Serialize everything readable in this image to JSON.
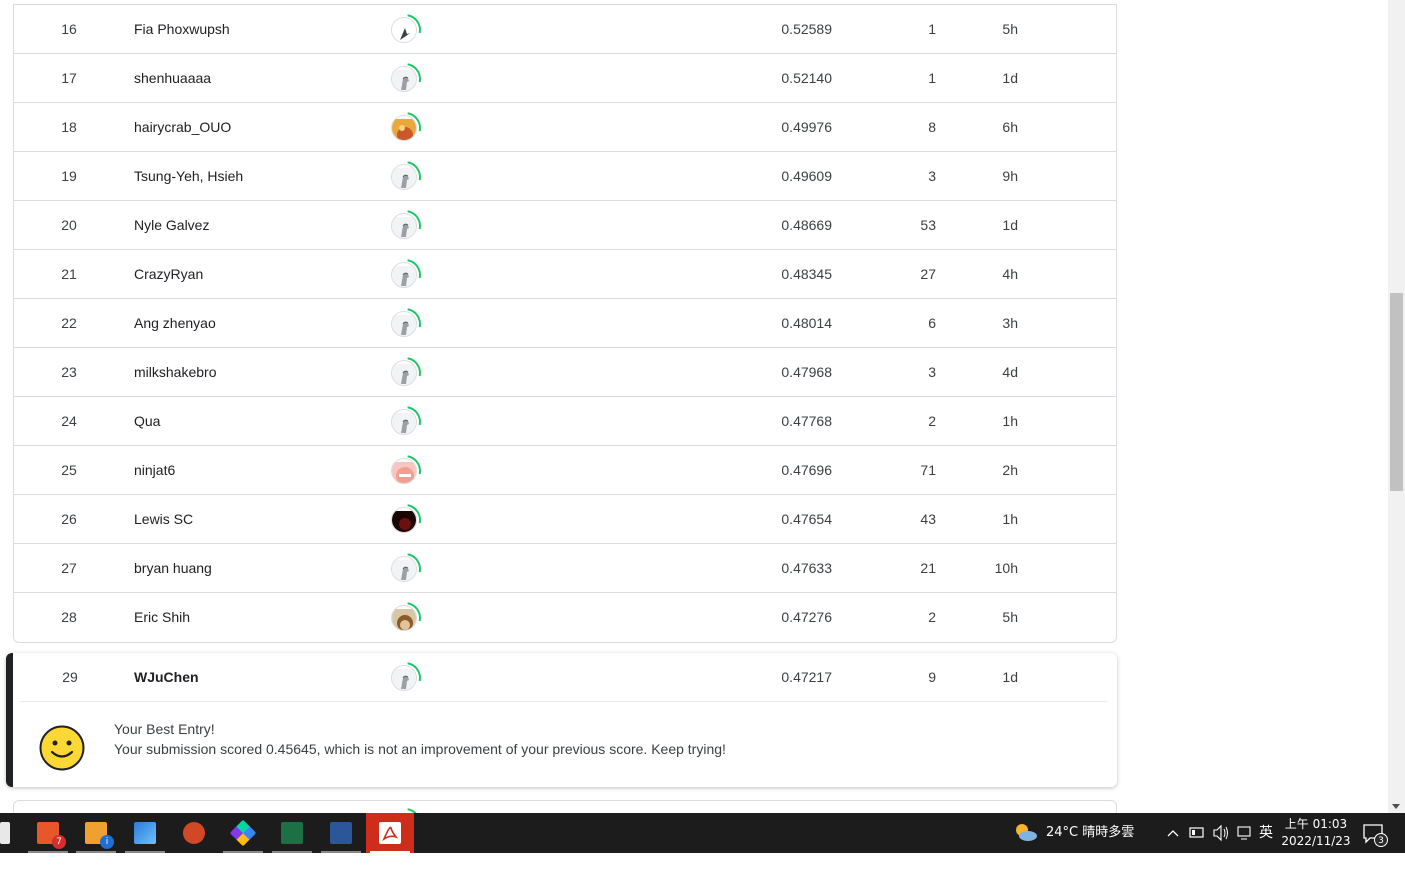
{
  "leaderboard": {
    "rows": [
      {
        "rank": "16",
        "name": "Fia Phoxwupsh",
        "score": "0.52589",
        "entries": "1",
        "last": "5h",
        "avatar": "logo"
      },
      {
        "rank": "17",
        "name": "shenhuaaaa",
        "score": "0.52140",
        "entries": "1",
        "last": "1d",
        "avatar": "default"
      },
      {
        "rank": "18",
        "name": "hairycrab_OUO",
        "score": "0.49976",
        "entries": "8",
        "last": "6h",
        "avatar": "orange"
      },
      {
        "rank": "19",
        "name": "Tsung-Yeh, Hsieh",
        "score": "0.49609",
        "entries": "3",
        "last": "9h",
        "avatar": "default"
      },
      {
        "rank": "20",
        "name": "Nyle Galvez",
        "score": "0.48669",
        "entries": "53",
        "last": "1d",
        "avatar": "default"
      },
      {
        "rank": "21",
        "name": "CrazyRyan",
        "score": "0.48345",
        "entries": "27",
        "last": "4h",
        "avatar": "default"
      },
      {
        "rank": "22",
        "name": "Ang zhenyao",
        "score": "0.48014",
        "entries": "6",
        "last": "3h",
        "avatar": "default"
      },
      {
        "rank": "23",
        "name": "milkshakebro",
        "score": "0.47968",
        "entries": "3",
        "last": "4d",
        "avatar": "default"
      },
      {
        "rank": "24",
        "name": "Qua",
        "score": "0.47768",
        "entries": "2",
        "last": "1h",
        "avatar": "default"
      },
      {
        "rank": "25",
        "name": "ninjat6",
        "score": "0.47696",
        "entries": "71",
        "last": "2h",
        "avatar": "pink"
      },
      {
        "rank": "26",
        "name": "Lewis SC",
        "score": "0.47654",
        "entries": "43",
        "last": "1h",
        "avatar": "dark"
      },
      {
        "rank": "27",
        "name": "bryan huang",
        "score": "0.47633",
        "entries": "21",
        "last": "10h",
        "avatar": "default"
      },
      {
        "rank": "28",
        "name": "Eric Shih",
        "score": "0.47276",
        "entries": "2",
        "last": "5h",
        "avatar": "photo"
      }
    ]
  },
  "my_entry": {
    "rank": "29",
    "name": "WJuChen",
    "score": "0.47217",
    "entries": "9",
    "last": "1d",
    "title": "Your Best Entry!",
    "message": "Your submission scored 0.45645, which is not an improvement of your previous score. Keep trying!"
  },
  "taskbar": {
    "apps": [
      "file-explorer",
      "task-app",
      "info-app",
      "photos",
      "powerpoint",
      "git",
      "excel",
      "word",
      "acrobat"
    ],
    "badge_counts": {
      "task_app": "7",
      "notifications": "3"
    },
    "weather": "24°C  晴時多雲",
    "ime": "英",
    "time": "上午 01:03",
    "date": "2022/11/23"
  },
  "colors": {
    "progress_ring": "#20beff",
    "ring_green": "#1ec766",
    "acrobat": "#cf2d1b"
  }
}
